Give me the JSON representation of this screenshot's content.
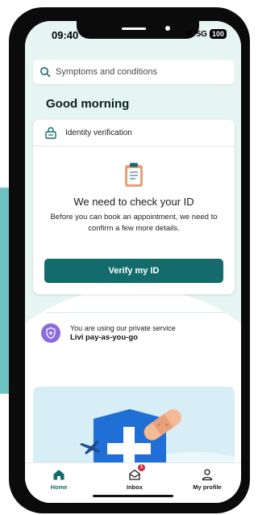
{
  "status_bar": {
    "time": "09:40",
    "network": "5G",
    "battery": "100"
  },
  "search": {
    "placeholder": "Symptoms and conditions"
  },
  "greeting": "Good morning",
  "verification_card": {
    "header": "Identity verification",
    "title": "We need to check your ID",
    "description": "Before you can book an appointment, we need to confirm a few more details.",
    "button_label": "Verify my ID"
  },
  "service": {
    "line1": "You are using our private service",
    "line2": "Livi pay-as-you-go"
  },
  "tabs": [
    {
      "label": "Home",
      "icon": "home-icon",
      "active": true
    },
    {
      "label": "Inbox",
      "icon": "inbox-icon",
      "badge": "1"
    },
    {
      "label": "My profile",
      "icon": "profile-icon"
    }
  ],
  "colors": {
    "accent": "#136b6b",
    "badge": "#d62a3c",
    "shield": "#8a6be0",
    "mint": "#e6f5f1"
  }
}
